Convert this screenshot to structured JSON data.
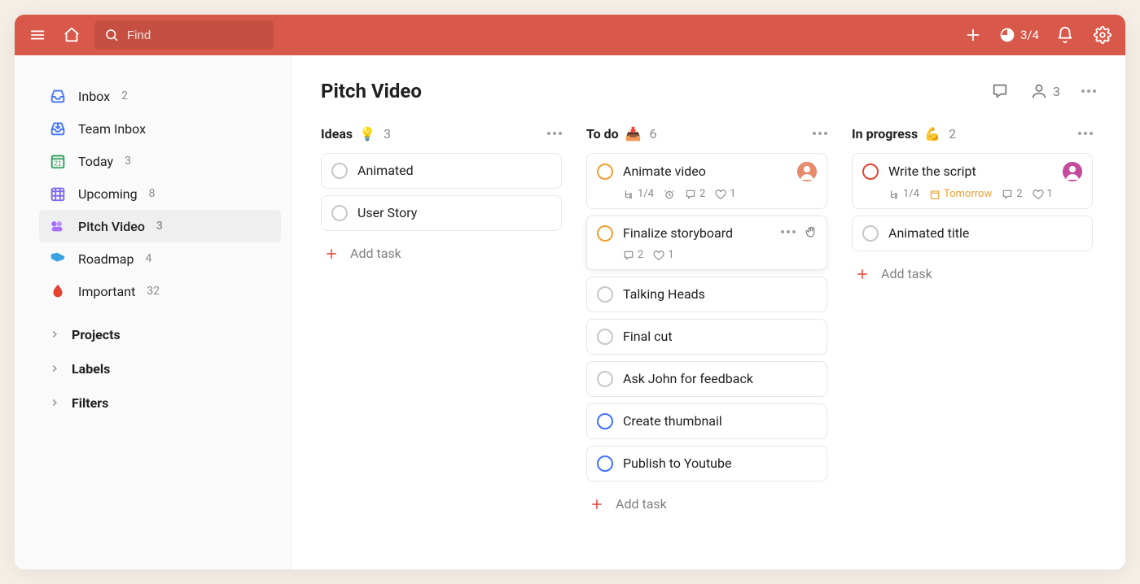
{
  "header": {
    "search_placeholder": "Find",
    "progress": "3/4"
  },
  "sidebar": {
    "items": [
      {
        "id": "inbox",
        "label": "Inbox",
        "count": "2"
      },
      {
        "id": "team-inbox",
        "label": "Team Inbox",
        "count": ""
      },
      {
        "id": "today",
        "label": "Today",
        "count": "3"
      },
      {
        "id": "upcoming",
        "label": "Upcoming",
        "count": "8"
      },
      {
        "id": "pitch-video",
        "label": "Pitch Video",
        "count": "3"
      },
      {
        "id": "roadmap",
        "label": "Roadmap",
        "count": "4"
      },
      {
        "id": "important",
        "label": "Important",
        "count": "32"
      }
    ],
    "sections": {
      "projects": "Projects",
      "labels": "Labels",
      "filters": "Filters"
    }
  },
  "page": {
    "title": "Pitch Video",
    "member_count": "3"
  },
  "board": {
    "add_task_label": "Add task",
    "columns": [
      {
        "id": "ideas",
        "title": "Ideas",
        "emoji": "💡",
        "count": "3",
        "cards": [
          {
            "title": "Animated"
          },
          {
            "title": "User Story"
          }
        ]
      },
      {
        "id": "todo",
        "title": "To do",
        "emoji": "📥",
        "count": "6",
        "cards": [
          {
            "title": "Animate video",
            "priority": "orange",
            "avatar": "a",
            "meta": {
              "subtasks": "1/4",
              "reminder": true,
              "comments": "2",
              "likes": "1"
            }
          },
          {
            "title": "Finalize storyboard",
            "priority": "orange",
            "hover": true,
            "meta": {
              "comments": "2",
              "likes": "1"
            }
          },
          {
            "title": "Talking Heads"
          },
          {
            "title": "Final cut"
          },
          {
            "title": "Ask John for feedback"
          },
          {
            "title": "Create thumbnail",
            "priority": "blue"
          },
          {
            "title": "Publish to Youtube",
            "priority": "blue"
          }
        ]
      },
      {
        "id": "inprogress",
        "title": "In progress",
        "emoji": "💪",
        "count": "2",
        "cards": [
          {
            "title": "Write the script",
            "priority": "red",
            "avatar": "b",
            "meta": {
              "subtasks": "1/4",
              "due": "Tomorrow",
              "comments": "2",
              "likes": "1"
            }
          },
          {
            "title": "Animated title"
          }
        ]
      }
    ]
  }
}
